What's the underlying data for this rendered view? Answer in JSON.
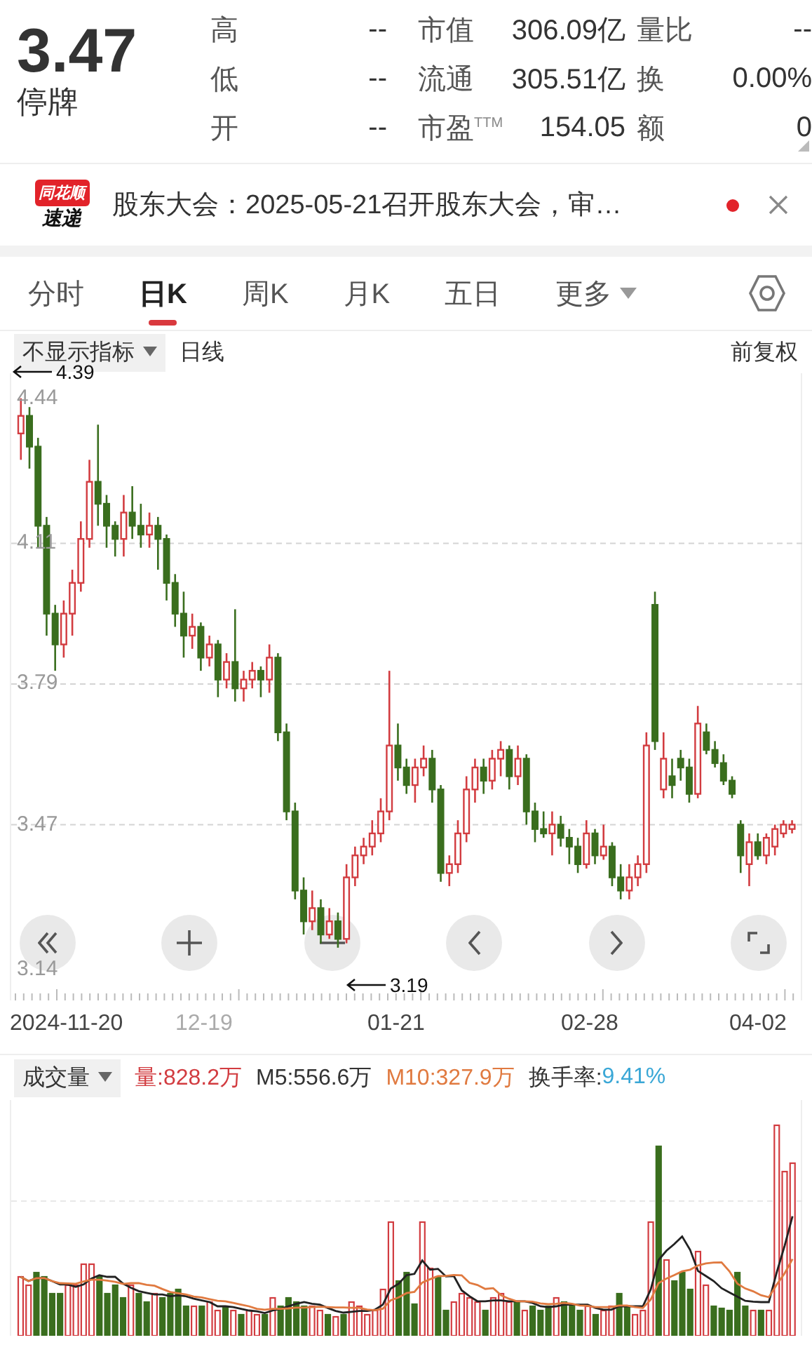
{
  "quote": {
    "price": "3.47",
    "status": "停牌"
  },
  "stats": [
    {
      "label": "高",
      "value": "--"
    },
    {
      "label": "市值",
      "value": "306.09亿"
    },
    {
      "label": "量比",
      "value": "--"
    },
    {
      "label": "低",
      "value": "--"
    },
    {
      "label": "流通",
      "value": "305.51亿"
    },
    {
      "label": "换",
      "value": "0.00%"
    },
    {
      "label": "开",
      "value": "--"
    },
    {
      "label": "市盈$^{TTM}$",
      "value": "154.05"
    },
    {
      "label": "额",
      "value": "0"
    }
  ],
  "news": {
    "logo_top": "同花顺",
    "logo_bottom": "速递",
    "text": "股东大会：2025-05-21召开股东大会，审…",
    "unread": true
  },
  "tabs": [
    {
      "label": "分时",
      "selected": false,
      "dropdown": false
    },
    {
      "label": "日K",
      "selected": true,
      "dropdown": false
    },
    {
      "label": "周K",
      "selected": false,
      "dropdown": false
    },
    {
      "label": "月K",
      "selected": false,
      "dropdown": false
    },
    {
      "label": "五日",
      "selected": false,
      "dropdown": false
    },
    {
      "label": "更多",
      "selected": false,
      "dropdown": true
    }
  ],
  "indicator": {
    "selector": "不显示指标",
    "period": "日线",
    "adjust": "前复权"
  },
  "chart": {
    "high_marker": "4.39",
    "low_marker": "3.19",
    "chart_data": {
      "type": "candlestick",
      "grid": true,
      "ylim": [
        3.07,
        4.497
      ],
      "yticks": [
        {
          "value": 4.44,
          "label": "4.44"
        },
        {
          "value": 4.11,
          "label": "4.11"
        },
        {
          "value": 3.79,
          "label": "3.79"
        },
        {
          "value": 3.47,
          "label": "3.47"
        },
        {
          "value": 3.14,
          "label": "3.14"
        }
      ],
      "ohlc": [
        [
          4.36,
          4.44,
          4.3,
          4.4
        ],
        [
          4.4,
          4.42,
          4.28,
          4.33
        ],
        [
          4.33,
          4.35,
          4.1,
          4.15
        ],
        [
          4.15,
          4.17,
          3.9,
          3.95
        ],
        [
          3.95,
          3.97,
          3.82,
          3.88
        ],
        [
          3.88,
          3.98,
          3.85,
          3.95
        ],
        [
          3.95,
          4.05,
          3.9,
          4.02
        ],
        [
          4.02,
          4.16,
          4.0,
          4.12
        ],
        [
          4.12,
          4.3,
          4.1,
          4.25
        ],
        [
          4.25,
          4.38,
          4.15,
          4.2
        ],
        [
          4.2,
          4.22,
          4.1,
          4.15
        ],
        [
          4.15,
          4.16,
          4.08,
          4.12
        ],
        [
          4.12,
          4.22,
          4.08,
          4.18
        ],
        [
          4.18,
          4.24,
          4.12,
          4.15
        ],
        [
          4.15,
          4.2,
          4.1,
          4.13
        ],
        [
          4.13,
          4.18,
          4.1,
          4.15
        ],
        [
          4.15,
          4.17,
          4.05,
          4.12
        ],
        [
          4.12,
          4.13,
          3.98,
          4.02
        ],
        [
          4.02,
          4.04,
          3.92,
          3.95
        ],
        [
          3.95,
          4.0,
          3.85,
          3.9
        ],
        [
          3.9,
          3.95,
          3.87,
          3.92
        ],
        [
          3.92,
          3.93,
          3.82,
          3.85
        ],
        [
          3.85,
          3.9,
          3.83,
          3.88
        ],
        [
          3.88,
          3.89,
          3.76,
          3.8
        ],
        [
          3.8,
          3.86,
          3.78,
          3.84
        ],
        [
          3.84,
          3.96,
          3.75,
          3.78
        ],
        [
          3.78,
          3.82,
          3.75,
          3.8
        ],
        [
          3.8,
          3.84,
          3.78,
          3.82
        ],
        [
          3.82,
          3.83,
          3.76,
          3.8
        ],
        [
          3.8,
          3.88,
          3.77,
          3.85
        ],
        [
          3.85,
          3.86,
          3.66,
          3.68
        ],
        [
          3.68,
          3.7,
          3.48,
          3.5
        ],
        [
          3.5,
          3.52,
          3.3,
          3.32
        ],
        [
          3.32,
          3.35,
          3.22,
          3.25
        ],
        [
          3.25,
          3.32,
          3.23,
          3.28
        ],
        [
          3.28,
          3.3,
          3.2,
          3.22
        ],
        [
          3.22,
          3.28,
          3.21,
          3.25
        ],
        [
          3.25,
          3.27,
          3.19,
          3.21
        ],
        [
          3.21,
          3.38,
          3.2,
          3.35
        ],
        [
          3.35,
          3.42,
          3.33,
          3.4
        ],
        [
          3.4,
          3.44,
          3.38,
          3.42
        ],
        [
          3.42,
          3.48,
          3.4,
          3.45
        ],
        [
          3.45,
          3.53,
          3.43,
          3.5
        ],
        [
          3.5,
          3.82,
          3.48,
          3.65
        ],
        [
          3.65,
          3.7,
          3.57,
          3.6
        ],
        [
          3.6,
          3.62,
          3.54,
          3.56
        ],
        [
          3.56,
          3.62,
          3.52,
          3.6
        ],
        [
          3.6,
          3.65,
          3.58,
          3.62
        ],
        [
          3.62,
          3.64,
          3.52,
          3.55
        ],
        [
          3.55,
          3.56,
          3.34,
          3.36
        ],
        [
          3.36,
          3.4,
          3.33,
          3.38
        ],
        [
          3.38,
          3.48,
          3.36,
          3.45
        ],
        [
          3.45,
          3.58,
          3.43,
          3.55
        ],
        [
          3.55,
          3.62,
          3.52,
          3.6
        ],
        [
          3.6,
          3.62,
          3.54,
          3.57
        ],
        [
          3.57,
          3.64,
          3.55,
          3.62
        ],
        [
          3.62,
          3.66,
          3.58,
          3.64
        ],
        [
          3.64,
          3.65,
          3.55,
          3.58
        ],
        [
          3.58,
          3.65,
          3.56,
          3.62
        ],
        [
          3.62,
          3.63,
          3.47,
          3.5
        ],
        [
          3.5,
          3.52,
          3.43,
          3.46
        ],
        [
          3.46,
          3.5,
          3.44,
          3.45
        ],
        [
          3.45,
          3.5,
          3.4,
          3.47
        ],
        [
          3.47,
          3.49,
          3.42,
          3.44
        ],
        [
          3.44,
          3.46,
          3.38,
          3.42
        ],
        [
          3.42,
          3.44,
          3.36,
          3.38
        ],
        [
          3.38,
          3.48,
          3.37,
          3.45
        ],
        [
          3.45,
          3.46,
          3.38,
          3.4
        ],
        [
          3.4,
          3.47,
          3.39,
          3.42
        ],
        [
          3.42,
          3.43,
          3.33,
          3.35
        ],
        [
          3.35,
          3.38,
          3.3,
          3.32
        ],
        [
          3.32,
          3.38,
          3.3,
          3.35
        ],
        [
          3.35,
          3.4,
          3.33,
          3.38
        ],
        [
          3.38,
          3.68,
          3.36,
          3.65
        ],
        [
          3.97,
          4.0,
          3.64,
          3.66
        ],
        [
          3.55,
          3.68,
          3.53,
          3.62
        ],
        [
          3.58,
          3.62,
          3.53,
          3.56
        ],
        [
          3.62,
          3.64,
          3.57,
          3.6
        ],
        [
          3.6,
          3.62,
          3.52,
          3.54
        ],
        [
          3.54,
          3.74,
          3.53,
          3.7
        ],
        [
          3.68,
          3.7,
          3.63,
          3.64
        ],
        [
          3.64,
          3.66,
          3.6,
          3.61
        ],
        [
          3.61,
          3.63,
          3.56,
          3.57
        ],
        [
          3.57,
          3.58,
          3.53,
          3.54
        ],
        [
          3.47,
          3.48,
          3.36,
          3.4
        ],
        [
          3.38,
          3.45,
          3.33,
          3.43
        ],
        [
          3.43,
          3.45,
          3.39,
          3.4
        ],
        [
          3.4,
          3.45,
          3.38,
          3.44
        ],
        [
          3.42,
          3.47,
          3.4,
          3.46
        ],
        [
          3.45,
          3.48,
          3.44,
          3.47
        ],
        [
          3.46,
          3.48,
          3.45,
          3.47
        ]
      ]
    },
    "buttons": [
      {
        "kind": "rewind"
      },
      {
        "kind": "zoom-in"
      },
      {
        "kind": "zoom-out"
      },
      {
        "kind": "prev"
      },
      {
        "kind": "next"
      },
      {
        "kind": "fullscreen"
      }
    ],
    "x_labels": [
      {
        "label": "2024-11-20",
        "dim": false
      },
      {
        "label": "12-19",
        "dim": true
      },
      {
        "label": "01-21",
        "dim": false
      },
      {
        "label": "02-28",
        "dim": false
      },
      {
        "label": "04-02",
        "dim": false
      }
    ]
  },
  "volume": {
    "selector": "成交量",
    "legend": [
      {
        "text": "量:828.2万",
        "color": "#d23c40"
      },
      {
        "text": "M5:556.6万",
        "color": "#333333"
      },
      {
        "text": "M10:327.9万",
        "color": "#e07a40"
      }
    ],
    "turnover_label": "换手率:",
    "turnover_value": "9.41%"
  }
}
